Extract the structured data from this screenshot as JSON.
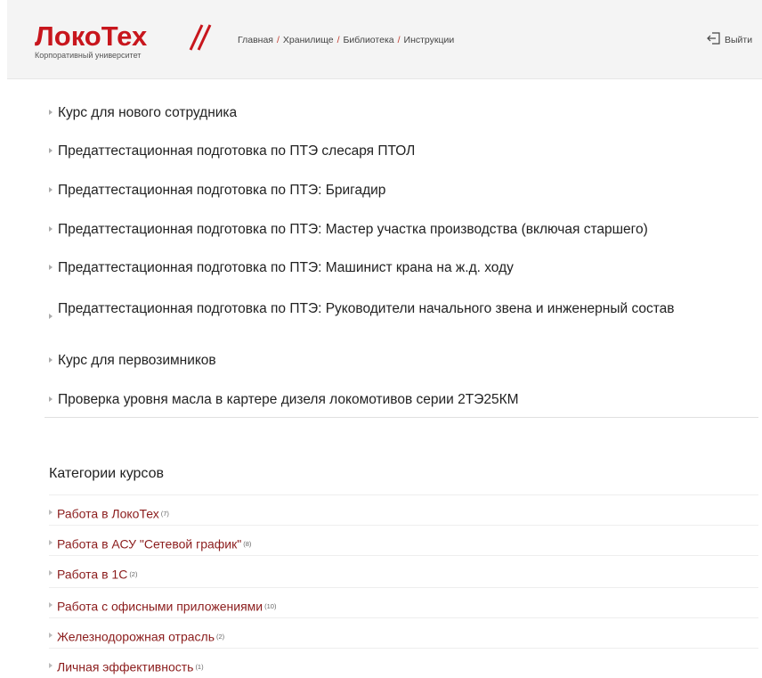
{
  "header": {
    "logo_text": "ЛокоТех",
    "logo_subtitle": "Корпоративный университет",
    "breadcrumb": [
      "Главная",
      "Хранилище",
      "Библиотека",
      "Инструкции"
    ],
    "breadcrumb_separator": "/",
    "logout_label": "Выйти",
    "accent_color": "#c8161d"
  },
  "courses": [
    "Курс для нового сотрудника",
    "Предаттестационная подготовка по ПТЭ слесаря ПТОЛ",
    "Предаттестационная подготовка по ПТЭ: Бригадир",
    "Предаттестационная подготовка по ПТЭ: Мастер участка производства (включая старшего)",
    "Предаттестационная подготовка по ПТЭ: Машинист крана на ж.д. ходу",
    "Предаттестационная подготовка по ПТЭ: Руководители начального звена и инженерный состав",
    "Курс для первозимников",
    "Проверка уровня масла в картере дизеля локомотивов серии 2ТЭ25КМ"
  ],
  "categories": {
    "title": "Категории курсов",
    "items": [
      {
        "name": "Работа в ЛокоТех",
        "count": "(7)"
      },
      {
        "name": "Работа в АСУ \"Сетевой график\"",
        "count": "(8)"
      },
      {
        "name": "Работа в 1С",
        "count": "(2)"
      },
      {
        "name": "Работа с офисными приложениями",
        "count": "(10)"
      },
      {
        "name": "Железнодорожная отрасль",
        "count": "(2)"
      },
      {
        "name": "Личная эффективность",
        "count": "(1)"
      }
    ]
  }
}
